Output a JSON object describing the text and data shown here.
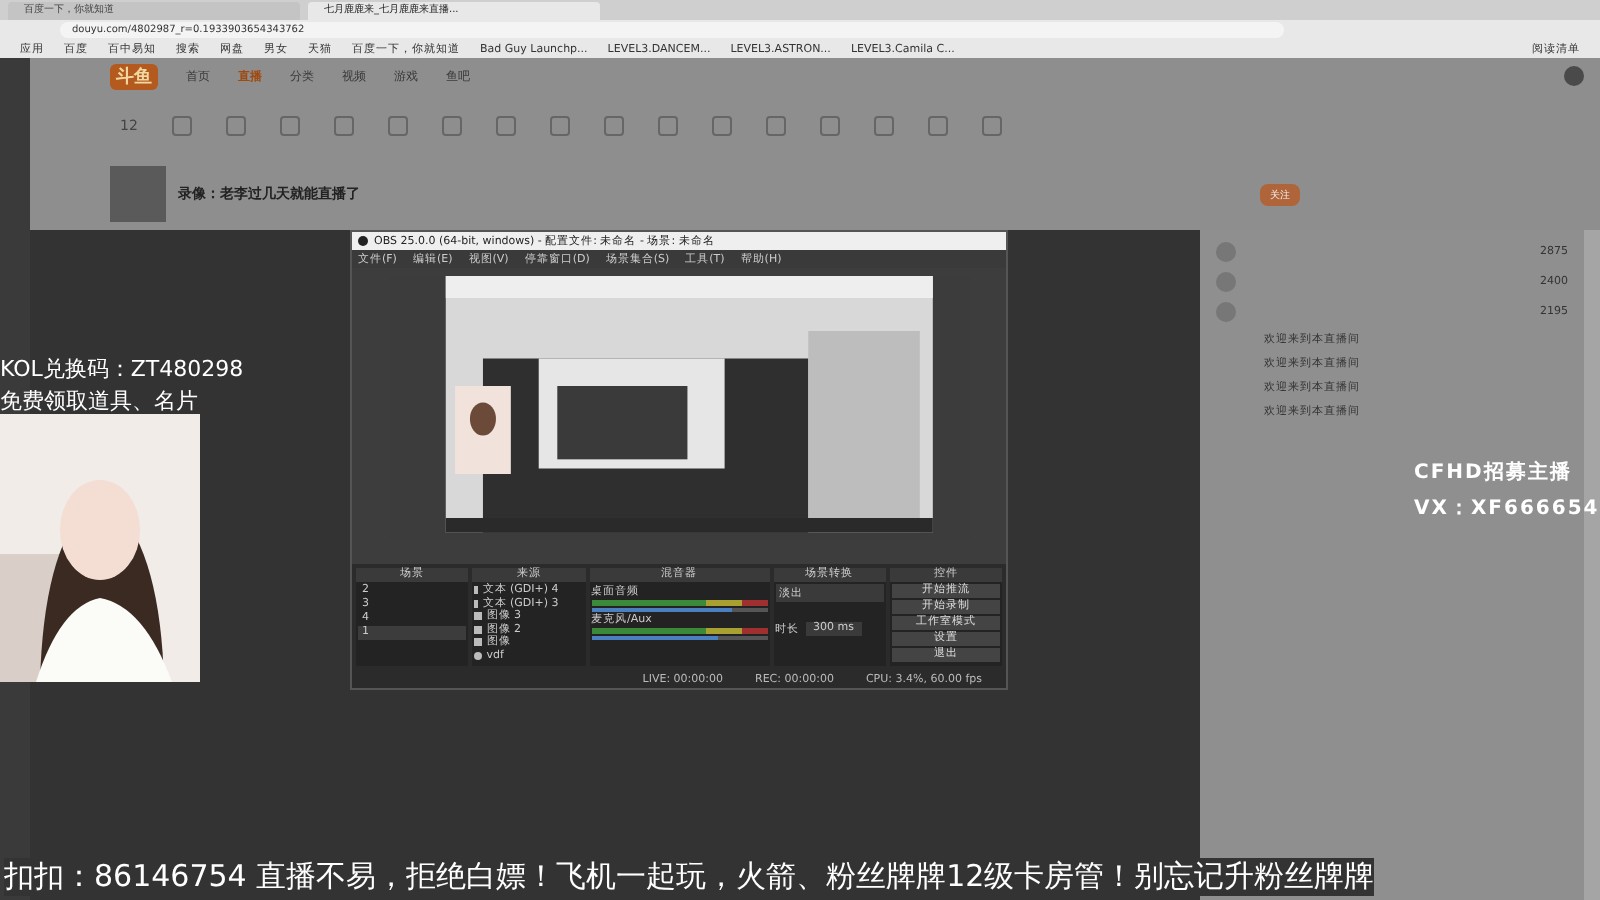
{
  "browser": {
    "tabs": [
      {
        "label": "百度一下，你就知道",
        "selected": false
      },
      {
        "label": "七月鹿鹿来_七月鹿鹿来直播...",
        "selected": true
      }
    ],
    "url": "douyu.com/4802987_r=0.1933903654343762",
    "bookmarks": [
      "应用",
      "百度",
      "百中易知",
      "搜索",
      "网盘",
      "男女",
      "天猫",
      "百度一下，你就知道",
      "Bad Guy Launchp...",
      "LEVEL3.DANCEM...",
      "LEVEL3.ASTRON...",
      "LEVEL3.Camila C..."
    ],
    "reading_list": "阅读清单"
  },
  "site": {
    "logo": "斗鱼",
    "nav": [
      {
        "label": "首页",
        "selected": false
      },
      {
        "label": "直播",
        "selected": true
      },
      {
        "label": "分类",
        "selected": false
      },
      {
        "label": "视频",
        "selected": false
      },
      {
        "label": "游戏",
        "selected": false
      },
      {
        "label": "鱼吧",
        "selected": false
      }
    ],
    "follow_count": "12",
    "stream_title": "录像：老李过几天就能直播了",
    "follow_button": "关注",
    "ranks": [
      {
        "value": "2875"
      },
      {
        "value": "2400"
      },
      {
        "value": "2195"
      }
    ],
    "welcome": [
      "欢迎来到本直播间",
      "欢迎来到本直播间",
      "欢迎来到本直播间",
      "欢迎来到本直播间"
    ]
  },
  "obs": {
    "title": "OBS 25.0.0 (64-bit, windows) - 配置文件: 未命名 - 场景: 未命名",
    "menu": [
      "文件(F)",
      "编辑(E)",
      "视图(V)",
      "停靠窗口(D)",
      "场景集合(S)",
      "工具(T)",
      "帮助(H)"
    ],
    "docks": [
      "场景",
      "来源",
      "混音器",
      "场景转换",
      "控件"
    ],
    "scenes": [
      {
        "label": "2",
        "selected": false
      },
      {
        "label": "3",
        "selected": false
      },
      {
        "label": "4",
        "selected": false
      },
      {
        "label": "1",
        "selected": true
      }
    ],
    "sources": [
      {
        "label": "文本 (GDI+) 4",
        "kind": "text"
      },
      {
        "label": "文本 (GDI+) 3",
        "kind": "text"
      },
      {
        "label": "图像 3"
      },
      {
        "label": "图像 2"
      },
      {
        "label": "图像"
      },
      {
        "label": "vdf",
        "kind": "capture"
      }
    ],
    "mixer": [
      {
        "name": "桌面音频",
        "level": 0.8
      },
      {
        "name": "麦克风/Aux",
        "level": 0.72
      }
    ],
    "transition": "淡出",
    "duration_label": "时长",
    "duration": "300 ms",
    "controls": [
      "开始推流",
      "开始录制",
      "工作室模式",
      "设置",
      "退出"
    ],
    "status": [
      "LIVE: 00:00:00",
      "REC: 00:00:00",
      "CPU: 3.4%, 60.00 fps"
    ]
  },
  "overlay": {
    "code": "KOL兑换码：ZT480298",
    "gift": "免费领取道具、名片",
    "recruit": "CFHD招募主播",
    "contact": "VX：XF666654",
    "ticker": "扣扣：86146754 直播不易，拒绝白嫖！飞机一起玩，火箭、粉丝牌牌12级卡房管！别忘记升粉丝牌牌"
  }
}
